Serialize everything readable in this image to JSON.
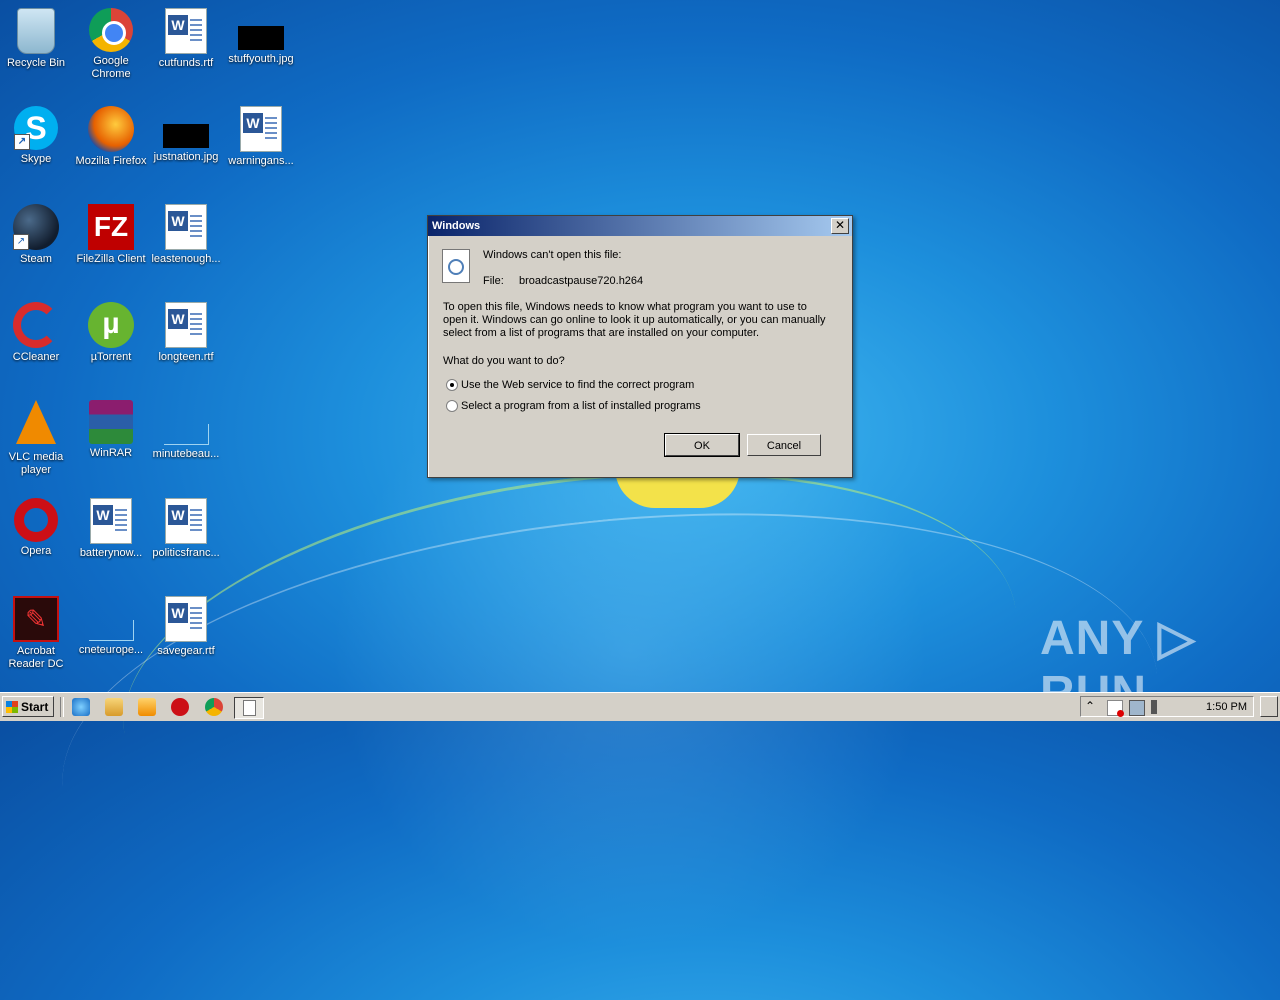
{
  "desktop": {
    "icons": [
      {
        "label": "Recycle Bin"
      },
      {
        "label": "Google Chrome"
      },
      {
        "label": "cutfunds.rtf"
      },
      {
        "label": "stuffyouth.jpg"
      },
      {
        "label": "Skype"
      },
      {
        "label": "Mozilla Firefox"
      },
      {
        "label": "justnation.jpg"
      },
      {
        "label": "warningans..."
      },
      {
        "label": "Steam"
      },
      {
        "label": "FileZilla Client"
      },
      {
        "label": "leastenough..."
      },
      {
        "label": "CCleaner"
      },
      {
        "label": "µTorrent"
      },
      {
        "label": "longteen.rtf"
      },
      {
        "label": "VLC media player"
      },
      {
        "label": "WinRAR"
      },
      {
        "label": "minutebeau..."
      },
      {
        "label": "Opera"
      },
      {
        "label": "batterynow..."
      },
      {
        "label": "politicsfranc..."
      },
      {
        "label": "Acrobat Reader DC"
      },
      {
        "label": "cneteurope..."
      },
      {
        "label": "savegear.rtf"
      }
    ]
  },
  "dialog": {
    "title": "Windows",
    "close_glyph": "✕",
    "heading": "Windows can't open this file:",
    "file_label": "File:",
    "file_name": "broadcastpause720.h264",
    "description_line1": "To open this file, Windows needs to know what program you want to use to",
    "description_line2": "open it. Windows can go online to look it up automatically, or you can manually",
    "description_line3": "select from a list of programs that are installed on your computer.",
    "question": "What do you want to do?",
    "option_web": "Use the Web service to find the correct program",
    "option_list": "Select a program from a list of installed programs",
    "ok_label": "OK",
    "cancel_label": "Cancel"
  },
  "taskbar": {
    "start_label": "Start",
    "clock": "1:50 PM",
    "tray_expand_glyph": "⌃"
  },
  "watermark": "ANY ▷ RUN",
  "colors": {
    "title_gradient_start": "#0a246a",
    "title_gradient_end": "#a6caf0",
    "dialog_bg": "#d4d0c8",
    "desktop_bg": "#1d8fdc"
  }
}
